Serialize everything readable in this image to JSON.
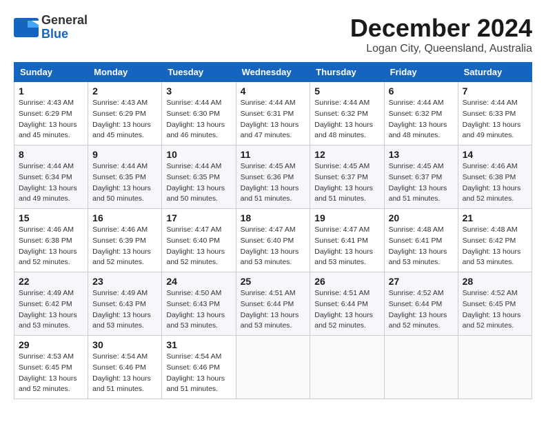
{
  "header": {
    "logo_general": "General",
    "logo_blue": "Blue",
    "month_title": "December 2024",
    "location": "Logan City, Queensland, Australia"
  },
  "calendar": {
    "days_of_week": [
      "Sunday",
      "Monday",
      "Tuesday",
      "Wednesday",
      "Thursday",
      "Friday",
      "Saturday"
    ],
    "weeks": [
      [
        {
          "day": "1",
          "sunrise": "4:43 AM",
          "sunset": "6:29 PM",
          "daylight": "13 hours and 45 minutes."
        },
        {
          "day": "2",
          "sunrise": "4:43 AM",
          "sunset": "6:29 PM",
          "daylight": "13 hours and 45 minutes."
        },
        {
          "day": "3",
          "sunrise": "4:44 AM",
          "sunset": "6:30 PM",
          "daylight": "13 hours and 46 minutes."
        },
        {
          "day": "4",
          "sunrise": "4:44 AM",
          "sunset": "6:31 PM",
          "daylight": "13 hours and 47 minutes."
        },
        {
          "day": "5",
          "sunrise": "4:44 AM",
          "sunset": "6:32 PM",
          "daylight": "13 hours and 48 minutes."
        },
        {
          "day": "6",
          "sunrise": "4:44 AM",
          "sunset": "6:32 PM",
          "daylight": "13 hours and 48 minutes."
        },
        {
          "day": "7",
          "sunrise": "4:44 AM",
          "sunset": "6:33 PM",
          "daylight": "13 hours and 49 minutes."
        }
      ],
      [
        {
          "day": "8",
          "sunrise": "4:44 AM",
          "sunset": "6:34 PM",
          "daylight": "13 hours and 49 minutes."
        },
        {
          "day": "9",
          "sunrise": "4:44 AM",
          "sunset": "6:35 PM",
          "daylight": "13 hours and 50 minutes."
        },
        {
          "day": "10",
          "sunrise": "4:44 AM",
          "sunset": "6:35 PM",
          "daylight": "13 hours and 50 minutes."
        },
        {
          "day": "11",
          "sunrise": "4:45 AM",
          "sunset": "6:36 PM",
          "daylight": "13 hours and 51 minutes."
        },
        {
          "day": "12",
          "sunrise": "4:45 AM",
          "sunset": "6:37 PM",
          "daylight": "13 hours and 51 minutes."
        },
        {
          "day": "13",
          "sunrise": "4:45 AM",
          "sunset": "6:37 PM",
          "daylight": "13 hours and 51 minutes."
        },
        {
          "day": "14",
          "sunrise": "4:46 AM",
          "sunset": "6:38 PM",
          "daylight": "13 hours and 52 minutes."
        }
      ],
      [
        {
          "day": "15",
          "sunrise": "4:46 AM",
          "sunset": "6:38 PM",
          "daylight": "13 hours and 52 minutes."
        },
        {
          "day": "16",
          "sunrise": "4:46 AM",
          "sunset": "6:39 PM",
          "daylight": "13 hours and 52 minutes."
        },
        {
          "day": "17",
          "sunrise": "4:47 AM",
          "sunset": "6:40 PM",
          "daylight": "13 hours and 52 minutes."
        },
        {
          "day": "18",
          "sunrise": "4:47 AM",
          "sunset": "6:40 PM",
          "daylight": "13 hours and 53 minutes."
        },
        {
          "day": "19",
          "sunrise": "4:47 AM",
          "sunset": "6:41 PM",
          "daylight": "13 hours and 53 minutes."
        },
        {
          "day": "20",
          "sunrise": "4:48 AM",
          "sunset": "6:41 PM",
          "daylight": "13 hours and 53 minutes."
        },
        {
          "day": "21",
          "sunrise": "4:48 AM",
          "sunset": "6:42 PM",
          "daylight": "13 hours and 53 minutes."
        }
      ],
      [
        {
          "day": "22",
          "sunrise": "4:49 AM",
          "sunset": "6:42 PM",
          "daylight": "13 hours and 53 minutes."
        },
        {
          "day": "23",
          "sunrise": "4:49 AM",
          "sunset": "6:43 PM",
          "daylight": "13 hours and 53 minutes."
        },
        {
          "day": "24",
          "sunrise": "4:50 AM",
          "sunset": "6:43 PM",
          "daylight": "13 hours and 53 minutes."
        },
        {
          "day": "25",
          "sunrise": "4:51 AM",
          "sunset": "6:44 PM",
          "daylight": "13 hours and 53 minutes."
        },
        {
          "day": "26",
          "sunrise": "4:51 AM",
          "sunset": "6:44 PM",
          "daylight": "13 hours and 52 minutes."
        },
        {
          "day": "27",
          "sunrise": "4:52 AM",
          "sunset": "6:44 PM",
          "daylight": "13 hours and 52 minutes."
        },
        {
          "day": "28",
          "sunrise": "4:52 AM",
          "sunset": "6:45 PM",
          "daylight": "13 hours and 52 minutes."
        }
      ],
      [
        {
          "day": "29",
          "sunrise": "4:53 AM",
          "sunset": "6:45 PM",
          "daylight": "13 hours and 52 minutes."
        },
        {
          "day": "30",
          "sunrise": "4:54 AM",
          "sunset": "6:46 PM",
          "daylight": "13 hours and 51 minutes."
        },
        {
          "day": "31",
          "sunrise": "4:54 AM",
          "sunset": "6:46 PM",
          "daylight": "13 hours and 51 minutes."
        },
        null,
        null,
        null,
        null
      ]
    ],
    "labels": {
      "sunrise": "Sunrise: ",
      "sunset": "Sunset: ",
      "daylight": "Daylight: "
    }
  }
}
